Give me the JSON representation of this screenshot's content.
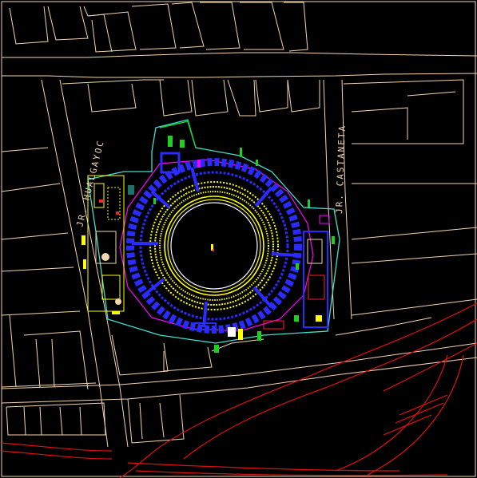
{
  "streets": {
    "west": "JR. HUALGAYOC",
    "east": "JR. CASTANETA"
  },
  "colors": {
    "background": "#000000",
    "parcel_lines": "#f3d5b0",
    "ring_yellow": "#ffff00",
    "ring_blue": "#2a2cff",
    "outline_cyan": "#40e0d0",
    "outline_magenta": "#ff00ff",
    "road_red": "#e01010",
    "accent_green": "#20d020"
  }
}
